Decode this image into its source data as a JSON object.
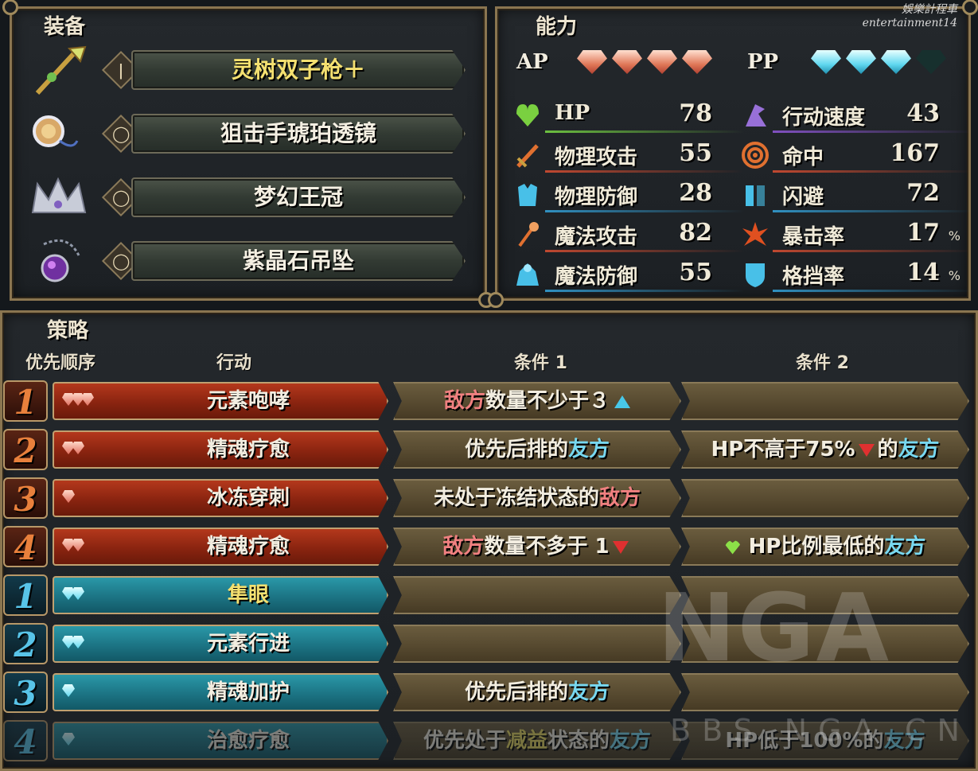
{
  "equipment": {
    "title": "装备",
    "items": [
      {
        "name": "灵树双子枪＋",
        "slot_icon": "weapon-slot-icon",
        "name_color": "#f4e070"
      },
      {
        "name": "狙击手琥珀透镜",
        "slot_icon": "accessory-slot-icon",
        "name_color": "#f4efe2"
      },
      {
        "name": "梦幻王冠",
        "slot_icon": "accessory-slot-icon",
        "name_color": "#f4efe2"
      },
      {
        "name": "紫晶石吊坠",
        "slot_icon": "accessory-slot-icon",
        "name_color": "#f4efe2"
      }
    ]
  },
  "ability": {
    "title": "能力",
    "ap_label": "AP",
    "pp_label": "PP",
    "ap_filled": 4,
    "ap_total": 4,
    "pp_filled": 3,
    "pp_total": 4,
    "stats_left": [
      {
        "label": "HP",
        "value": "78",
        "icon": "heart-icon",
        "line_color": "#6cc040"
      },
      {
        "label": "物理攻击",
        "value": "55",
        "icon": "sword-icon",
        "line_color": "#c04830"
      },
      {
        "label": "物理防御",
        "value": "28",
        "icon": "armor-icon",
        "line_color": "#3090c0"
      },
      {
        "label": "魔法攻击",
        "value": "82",
        "icon": "staff-icon",
        "line_color": "#c04830"
      },
      {
        "label": "魔法防御",
        "value": "55",
        "icon": "robe-icon",
        "line_color": "#3090c0"
      }
    ],
    "stats_right": [
      {
        "label": "行动速度",
        "value": "43",
        "icon": "boot-icon",
        "line_color": "#8050c0",
        "unit": ""
      },
      {
        "label": "命中",
        "value": "167",
        "icon": "target-icon",
        "line_color": "#c04830",
        "unit": ""
      },
      {
        "label": "闪避",
        "value": "72",
        "icon": "evade-icon",
        "line_color": "#3090c0",
        "unit": ""
      },
      {
        "label": "暴击率",
        "value": "17",
        "icon": "crit-icon",
        "line_color": "#c04830",
        "unit": "%"
      },
      {
        "label": "格挡率",
        "value": "14",
        "icon": "shield-icon",
        "line_color": "#3090c0",
        "unit": "%"
      }
    ]
  },
  "strategy": {
    "title": "策略",
    "headers": {
      "priority": "优先顺序",
      "action": "行动",
      "cond1": "条件 1",
      "cond2": "条件 2"
    },
    "rows": [
      {
        "num": "1",
        "type": "red",
        "gems": 3,
        "action": "元素咆哮",
        "cond1": [
          {
            "t": "敌方",
            "c": "enemy"
          },
          {
            "t": "数量不少于３",
            "c": ""
          }
        ],
        "cond1_marker": "up",
        "cond2": []
      },
      {
        "num": "2",
        "type": "red",
        "gems": 2,
        "action": "精魂疗愈",
        "cond1": [
          {
            "t": "优先后排的",
            "c": ""
          },
          {
            "t": "友方",
            "c": "ally"
          }
        ],
        "cond2": [
          {
            "t": "HP不高于75%",
            "c": ""
          },
          {
            "t": "▼",
            "c": "down"
          },
          {
            "t": "的",
            "c": ""
          },
          {
            "t": "友方",
            "c": "ally"
          }
        ]
      },
      {
        "num": "3",
        "type": "red",
        "gems": 1,
        "action": "冰冻穿刺",
        "cond1": [
          {
            "t": "未处于冻结状态的",
            "c": ""
          },
          {
            "t": "敌方",
            "c": "enemy"
          }
        ],
        "cond2": []
      },
      {
        "num": "4",
        "type": "red",
        "gems": 2,
        "action": "精魂疗愈",
        "cond1": [
          {
            "t": "敌方",
            "c": "enemy"
          },
          {
            "t": "数量不多于 1",
            "c": ""
          }
        ],
        "cond1_marker": "down",
        "cond2": [
          {
            "t": "♥",
            "c": "heart"
          },
          {
            "t": "HP比例最低的",
            "c": ""
          },
          {
            "t": "友方",
            "c": "ally"
          }
        ]
      },
      {
        "num": "1",
        "type": "blue",
        "gems": 2,
        "action": "隼眼",
        "action_color": "#f4e070",
        "cond1": [],
        "cond2": []
      },
      {
        "num": "2",
        "type": "blue",
        "gems": 2,
        "action": "元素行进",
        "cond1": [],
        "cond2": []
      },
      {
        "num": "3",
        "type": "blue",
        "gems": 1,
        "action": "精魂加护",
        "cond1": [
          {
            "t": "优先后排的",
            "c": ""
          },
          {
            "t": "友方",
            "c": "ally"
          }
        ],
        "cond2": []
      },
      {
        "num": "4",
        "type": "blue",
        "gems": 1,
        "action": "治愈疗愈",
        "faded": true,
        "cond1": [
          {
            "t": "优先处于",
            "c": ""
          },
          {
            "t": "减益",
            "c": "debuff"
          },
          {
            "t": "状态的",
            "c": ""
          },
          {
            "t": "友方",
            "c": "ally"
          }
        ],
        "cond2": [
          {
            "t": "HP低于100%的",
            "c": ""
          },
          {
            "t": "友方",
            "c": "ally"
          }
        ]
      }
    ]
  },
  "watermarks": {
    "top_right_line1": "娛樂計程車",
    "top_right_line2": "entertainment14",
    "nga": "NGA",
    "bbs": "BBS.NGA.CN"
  }
}
